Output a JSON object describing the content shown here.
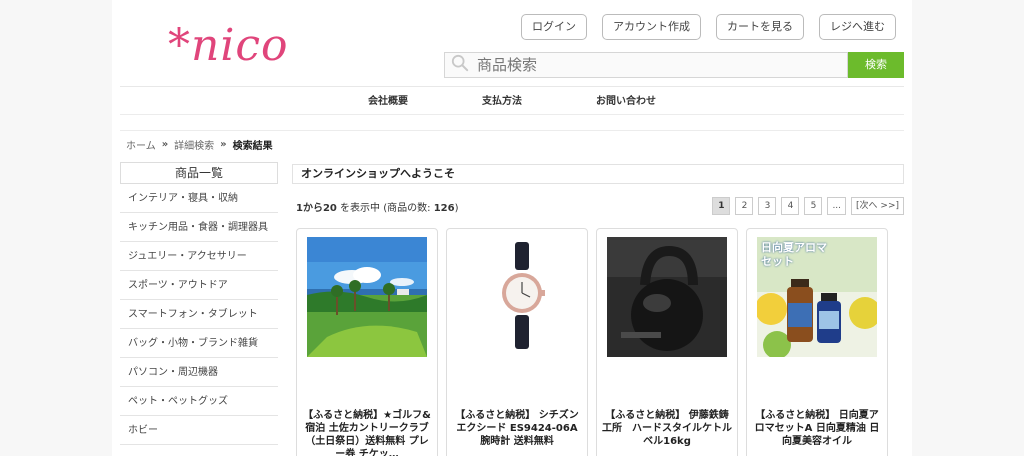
{
  "logo": {
    "text": "*nico"
  },
  "header": {
    "buttons": [
      "ログイン",
      "アカウント作成",
      "カートを見る",
      "レジへ進む"
    ]
  },
  "search": {
    "placeholder": "商品検索",
    "button_label": "検索"
  },
  "gnav": [
    "会社概要",
    "支払方法",
    "お問い合わせ"
  ],
  "breadcrumb": {
    "home": "ホーム",
    "sep": "»",
    "detail": "詳細検索",
    "current": "検索結果"
  },
  "sidebar": {
    "title": "商品一覧",
    "items": [
      "インテリア・寝具・収納",
      "キッチン用品・食器・調理器具",
      "ジュエリー・アクセサリー",
      "スポーツ・アウトドア",
      "スマートフォン・タブレット",
      "バッグ・小物・ブランド雑貨",
      "パソコン・周辺機器",
      "ペット・ペットグッズ",
      "ホビー"
    ]
  },
  "main": {
    "welcome": "オンラインショップへようこそ",
    "count": {
      "range": "1から20",
      "mid": " を表示中 (商品の数: ",
      "total": "126",
      "end": ")"
    },
    "pager": [
      "1",
      "2",
      "3",
      "4",
      "5",
      "...",
      "[次へ >>]"
    ],
    "products": [
      {
        "title": "【ふるさと納税】★ゴルフ&宿泊 土佐カントリークラブ（土日祭日）送料無料 プレー券 チケッ…"
      },
      {
        "title": "【ふるさと納税】 シチズン エクシード ES9424-06A 腕時計 送料無料"
      },
      {
        "title": "【ふるさと納税】 伊藤鉄鋳工所　ハードスタイルケトルベル16kg"
      },
      {
        "title": "【ふるさと納税】 日向夏アロマセットA 日向夏精油 日向夏美容オイル"
      }
    ],
    "aroma_label": "日向夏アロマセット"
  },
  "colors": {
    "brand": "#e0457b",
    "search_button": "#6cbb2c"
  }
}
